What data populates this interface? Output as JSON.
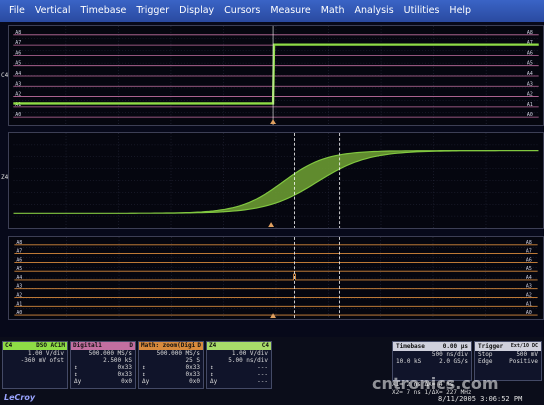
{
  "menu": [
    "File",
    "Vertical",
    "Timebase",
    "Trigger",
    "Display",
    "Cursors",
    "Measure",
    "Math",
    "Analysis",
    "Utilities",
    "Help"
  ],
  "panel1": {
    "traces": [
      "A8",
      "A7",
      "A6",
      "A5",
      "A4",
      "A3",
      "A2",
      "A1",
      "A0"
    ],
    "left_marker": "C4"
  },
  "panel2": {
    "left_marker": "Z4"
  },
  "panel3": {
    "traces": [
      "A8",
      "A7",
      "A6",
      "A5",
      "A4",
      "A3",
      "A2",
      "A1",
      "A0"
    ]
  },
  "colors": {
    "green": "#8fdc46",
    "pink": "#c26fa0",
    "orange": "#d88a3c",
    "grid": "#2a2c40",
    "cursor": "#ffffff"
  },
  "channels": {
    "c4": {
      "name": "C4",
      "badges": "DSO AC1M",
      "row1": "1.00 V/div",
      "row2": "-360 mV ofst"
    },
    "digital": {
      "name": "Digital1",
      "badge": "D",
      "rate": "500.000 MS/s",
      "pts": "2.500 kS",
      "r3": "0x33",
      "r4": "0x33",
      "r5": "0x0",
      "dy": "Δy"
    },
    "math": {
      "name": "Math: zoom(Digi",
      "badge": "D",
      "rate": "500.000 MS/s",
      "pts": "25 S",
      "r3": "0x33",
      "r4": "0x33",
      "r5": "0x0",
      "dy": "Δy"
    },
    "z4": {
      "name": "Z4",
      "badge": "C4",
      "row1": "1.00 V/div",
      "row2": "5.00 ns/div",
      "r3": "---",
      "r4": "---",
      "r5": "---",
      "dy": "Δy"
    }
  },
  "timebase": {
    "label": "Timebase",
    "value": "0.00 µs",
    "r1a": "500 ns/div",
    "r1b": "",
    "r2a": "10.0 kS",
    "r2b": "2.0 GS/s"
  },
  "trigger": {
    "label": "Trigger",
    "badge": "Ext/10 DC",
    "r1a": "Stop",
    "r1b": "500 mV",
    "r2a": "Edge",
    "r2b": "Positive"
  },
  "cursors": {
    "l1": "X1=   2 ns    ΔX=       4 ns",
    "l2": "X2=   7 ns   1/ΔX=   227 MHz"
  },
  "brand": "LeCroy",
  "datetime": "8/11/2005 3:06:52 PM",
  "watermark": "cntronics.com"
}
